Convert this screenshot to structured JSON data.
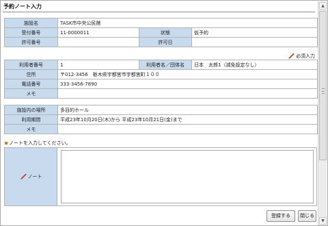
{
  "title": "予約ノート入力",
  "section1": {
    "facility_label": "施設名",
    "facility_value": "TASK市中央公民館",
    "reception_no_label": "受付番号",
    "reception_no_value": "11-0000011",
    "status_label": "状態",
    "status_value": "仮予約",
    "permit_no_label": "許可番号",
    "permit_no_value": "",
    "permit_date_label": "許可日",
    "permit_date_value": ""
  },
  "required_note": "必須入力",
  "section2": {
    "user_no_label": "利用者番号",
    "user_no_value": "1",
    "user_name_label": "利用者名／団体名",
    "user_name_value": "日本　太郎1（減免設定なし）",
    "address_label": "住所",
    "address_value": "〒012-3456　栃木県宇都宮市宇都宮町１００",
    "phone_label": "電話番号",
    "phone_value": "333-3456-7890",
    "memo_label": "メモ",
    "memo_value": ""
  },
  "section3": {
    "place_label": "施設内の場所",
    "place_value": "多目的ホール",
    "period_label": "利用期間",
    "period_value": "平成23年10月20日(木)から 平成23年10月21日(金)まで",
    "memo_label": "メモ",
    "memo_value": ""
  },
  "hint": "ノートを入力してください。",
  "note_label": "ノート",
  "note_value": "",
  "buttons": {
    "save": "登録する",
    "close": "閉じる"
  },
  "colors": {
    "label_bg": "#c8dbee",
    "border": "#b3b3b3",
    "hint_bullet": "#e07a1f",
    "pen_red": "#d23a2a"
  },
  "icons": {
    "required": "pencil-icon",
    "note": "pencil-icon",
    "hint": "bullet-icon"
  }
}
